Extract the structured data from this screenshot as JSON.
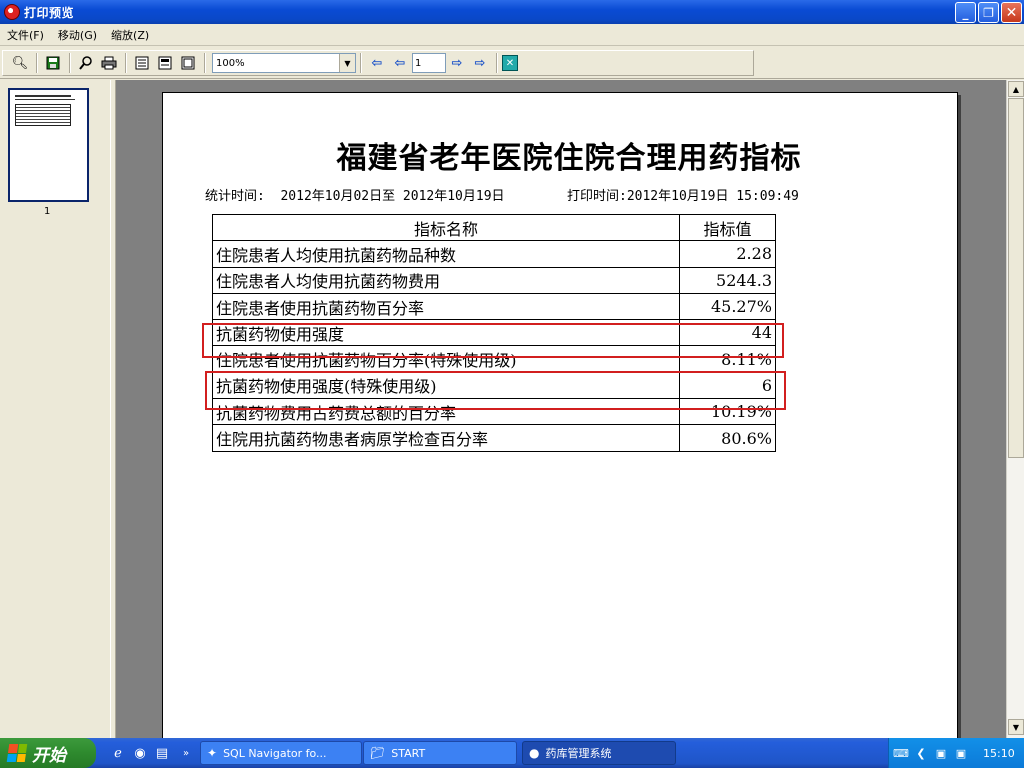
{
  "window": {
    "title": "打印预览"
  },
  "menu": [
    "文件(F)",
    "移动(G)",
    "缩放(Z)"
  ],
  "toolbar": {
    "zoom_value": "100%",
    "page_number": "1"
  },
  "thumbnail": {
    "label": "1"
  },
  "report": {
    "title": "福建省老年医院住院合理用药指标",
    "stat_label": "统计时间:",
    "stat_range": "2012年10月02日至 2012年10月19日",
    "print_label": "打印时间:",
    "print_time": "2012年10月19日 15:09:49",
    "table": {
      "headers": [
        "指标名称",
        "指标值"
      ],
      "rows": [
        {
          "name": "住院患者人均使用抗菌药物品种数",
          "value": "2.28",
          "highlighted": false
        },
        {
          "name": "住院患者人均使用抗菌药物费用",
          "value": "5244.3",
          "highlighted": false
        },
        {
          "name": "住院患者使用抗菌药物百分率",
          "value": "45.27%",
          "highlighted": false
        },
        {
          "name": "抗菌药物使用强度",
          "value": "44",
          "highlighted": true
        },
        {
          "name": "住院患者使用抗菌药物百分率(特殊使用级)",
          "value": "8.11%",
          "highlighted": false
        },
        {
          "name": "抗菌药物使用强度(特殊使用级)",
          "value": "6",
          "highlighted": true
        },
        {
          "name": "抗菌药物费用占药费总额的百分率",
          "value": "10.19%",
          "highlighted": false
        },
        {
          "name": "住院用抗菌药物患者病原学检查百分率",
          "value": "80.6%",
          "highlighted": false
        }
      ]
    }
  },
  "taskbar": {
    "start_label": "开始",
    "tasks": [
      "SQL Navigator fo...",
      "START",
      "药库管理系统"
    ],
    "clock": "15:10"
  },
  "colors": {
    "highlight_box": "#d21f1f",
    "titlebar": "#0a4bd4",
    "preview_bg": "#808080"
  }
}
